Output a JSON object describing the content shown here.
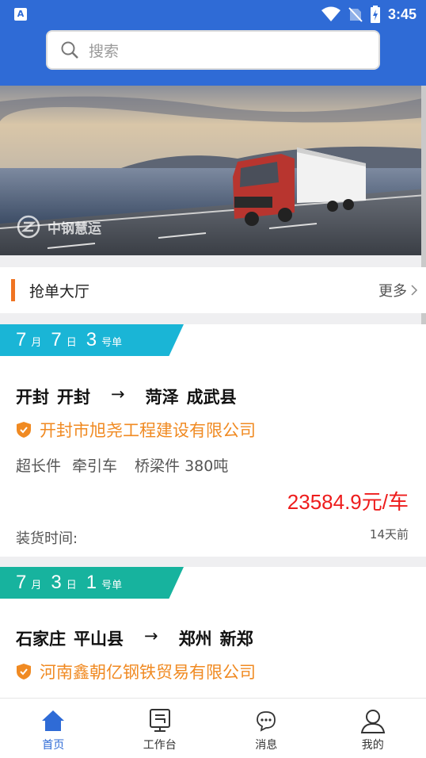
{
  "status_bar": {
    "time": "3:45",
    "app_badge": "A"
  },
  "search": {
    "placeholder": "搜索"
  },
  "banner": {
    "brand": "中钢慧运"
  },
  "hall": {
    "title": "抢单大厅",
    "more_label": "更多"
  },
  "orders": [
    {
      "tag": {
        "month": "7",
        "month_unit": "月",
        "day": "7",
        "day_unit": "日",
        "num": "3",
        "num_unit": "号单",
        "color": "#1ab5d6"
      },
      "origin": [
        "开封",
        "开封"
      ],
      "arrow": "→",
      "destination": [
        "菏泽",
        "成武县"
      ],
      "company": "开封市旭尧工程建设有限公司",
      "cargo": [
        "超长件",
        "牵引车",
        "桥梁件 380吨"
      ],
      "price": "23584.9元/车",
      "load_label": "装货时间:",
      "ago": "14天前"
    },
    {
      "tag": {
        "month": "7",
        "month_unit": "月",
        "day": "3",
        "day_unit": "日",
        "num": "1",
        "num_unit": "号单",
        "color": "#17b39e"
      },
      "origin": [
        "石家庄",
        "平山县"
      ],
      "arrow": "→",
      "destination": [
        "郑州",
        "新郑"
      ],
      "company": "河南鑫朝亿钢铁贸易有限公司"
    }
  ],
  "tabbar": {
    "items": [
      {
        "label": "首页",
        "icon": "home-icon",
        "active": true
      },
      {
        "label": "工作台",
        "icon": "workbench-icon",
        "active": false
      },
      {
        "label": "消息",
        "icon": "message-icon",
        "active": false
      },
      {
        "label": "我的",
        "icon": "user-icon",
        "active": false
      }
    ]
  },
  "colors": {
    "primary": "#2f6bd6",
    "accent_orange": "#f08a22",
    "price_red": "#ee1c1c"
  }
}
